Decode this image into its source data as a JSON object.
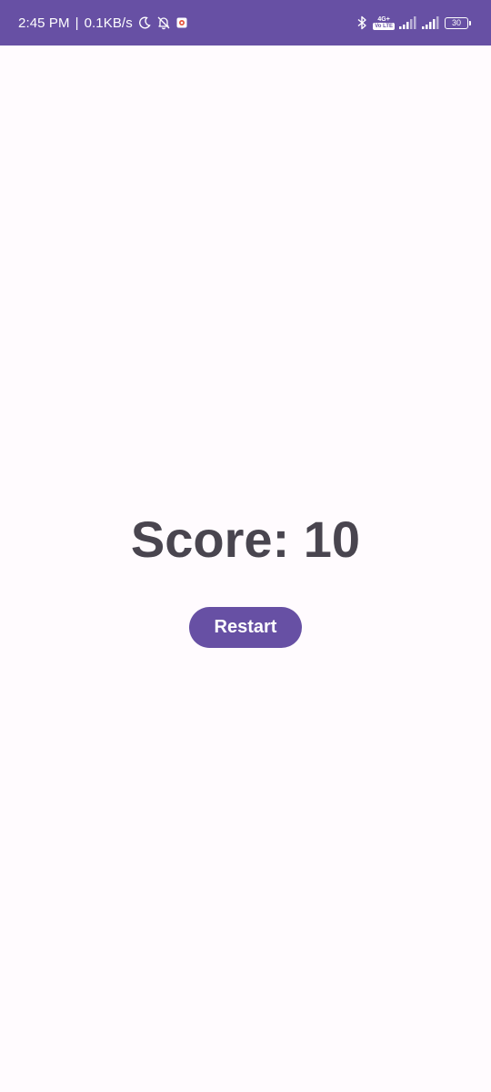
{
  "status_bar": {
    "time": "2:45 PM",
    "separator": "|",
    "net_speed": "0.1KB/s",
    "network_type_top": "4G+",
    "network_type_box": "Vo LTE",
    "battery_level": "30",
    "background_color": "#6750a4",
    "icons": [
      "moon-icon",
      "bell-off-icon",
      "app-notification-icon",
      "bluetooth-icon",
      "volte-icon",
      "signal-icon",
      "signal-icon-2",
      "battery-icon"
    ]
  },
  "main": {
    "score_text": "Score: 10",
    "restart_label": "Restart",
    "accent_color": "#6750a4",
    "text_color": "#49454f",
    "background_color": "#fffbfe"
  }
}
